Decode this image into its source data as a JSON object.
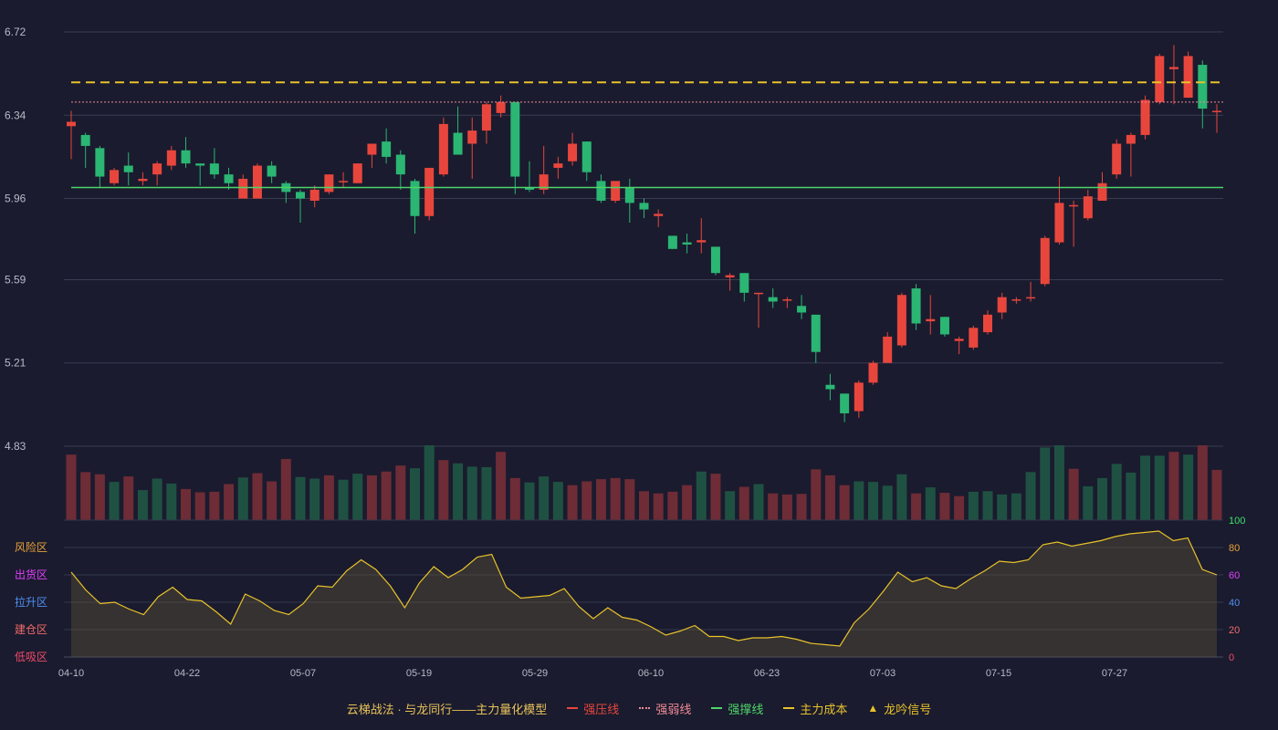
{
  "chart_data": {
    "type": "candlestick",
    "x_ticks": [
      "04-10",
      "04-22",
      "05-07",
      "05-19",
      "05-29",
      "06-10",
      "06-23",
      "07-03",
      "07-15",
      "07-27"
    ],
    "y_ticks": [
      "6.72",
      "6.34",
      "5.96",
      "5.59",
      "5.21",
      "4.83"
    ],
    "price_range": [
      4.83,
      6.72
    ],
    "lines": {
      "resistance": 6.4,
      "weak": 6.45,
      "support": 6.01,
      "cost": 6.49
    },
    "candles": [
      [
        6.29,
        6.31,
        6.36,
        6.14
      ],
      [
        6.25,
        6.2,
        6.26,
        6.1
      ],
      [
        6.19,
        6.06,
        6.2,
        6.01
      ],
      [
        6.03,
        6.09,
        6.1,
        6.02
      ],
      [
        6.11,
        6.08,
        6.17,
        6.02
      ],
      [
        6.04,
        6.05,
        6.08,
        6.02
      ],
      [
        6.07,
        6.12,
        6.13,
        6.02
      ],
      [
        6.11,
        6.18,
        6.2,
        6.09
      ],
      [
        6.18,
        6.12,
        6.24,
        6.1
      ],
      [
        6.12,
        6.11,
        6.12,
        6.02
      ],
      [
        6.12,
        6.07,
        6.19,
        6.05
      ],
      [
        6.07,
        6.03,
        6.1,
        6.0
      ],
      [
        5.96,
        6.05,
        6.07,
        5.96
      ],
      [
        5.96,
        6.11,
        6.12,
        5.96
      ],
      [
        6.11,
        6.06,
        6.13,
        6.03
      ],
      [
        6.03,
        5.99,
        6.04,
        5.94
      ],
      [
        5.99,
        5.96,
        6.0,
        5.85
      ],
      [
        5.95,
        6.0,
        6.02,
        5.92
      ],
      [
        5.99,
        6.07,
        6.07,
        5.98
      ],
      [
        6.04,
        6.04,
        6.08,
        6.01
      ],
      [
        6.03,
        6.12,
        6.12,
        6.03
      ],
      [
        6.16,
        6.21,
        6.21,
        6.1
      ],
      [
        6.22,
        6.15,
        6.28,
        6.12
      ],
      [
        6.16,
        6.07,
        6.18,
        6.0
      ],
      [
        6.04,
        5.88,
        6.05,
        5.8
      ],
      [
        5.88,
        6.1,
        6.1,
        5.86
      ],
      [
        6.07,
        6.3,
        6.33,
        6.06
      ],
      [
        6.26,
        6.16,
        6.38,
        6.16
      ],
      [
        6.21,
        6.27,
        6.33,
        6.05
      ],
      [
        6.27,
        6.39,
        6.4,
        6.21
      ],
      [
        6.35,
        6.4,
        6.43,
        6.33
      ],
      [
        6.4,
        6.06,
        6.4,
        5.98
      ],
      [
        6.01,
        6.0,
        6.13,
        5.99
      ],
      [
        6.0,
        6.07,
        6.2,
        5.98
      ],
      [
        6.1,
        6.12,
        6.15,
        6.05
      ],
      [
        6.13,
        6.21,
        6.26,
        6.11
      ],
      [
        6.22,
        6.08,
        6.22,
        6.04
      ],
      [
        6.04,
        5.95,
        6.07,
        5.94
      ],
      [
        5.95,
        6.04,
        6.04,
        5.94
      ],
      [
        6.01,
        5.94,
        6.05,
        5.85
      ],
      [
        5.94,
        5.91,
        5.96,
        5.87
      ],
      [
        5.88,
        5.89,
        5.91,
        5.83
      ],
      [
        5.79,
        5.73,
        5.79,
        5.73
      ],
      [
        5.76,
        5.75,
        5.8,
        5.71
      ],
      [
        5.76,
        5.77,
        5.87,
        5.71
      ],
      [
        5.74,
        5.62,
        5.74,
        5.61
      ],
      [
        5.6,
        5.61,
        5.62,
        5.54
      ],
      [
        5.62,
        5.53,
        5.62,
        5.49
      ],
      [
        5.53,
        5.53,
        5.53,
        5.37
      ],
      [
        5.51,
        5.49,
        5.55,
        5.46
      ],
      [
        5.5,
        5.5,
        5.51,
        5.46
      ],
      [
        5.47,
        5.44,
        5.52,
        5.41
      ],
      [
        5.43,
        5.26,
        5.43,
        5.21
      ],
      [
        5.11,
        5.09,
        5.16,
        5.04
      ],
      [
        5.07,
        4.98,
        5.07,
        4.94
      ],
      [
        4.99,
        5.12,
        5.13,
        4.96
      ],
      [
        5.12,
        5.21,
        5.22,
        5.11
      ],
      [
        5.21,
        5.33,
        5.35,
        5.21
      ],
      [
        5.29,
        5.52,
        5.53,
        5.28
      ],
      [
        5.55,
        5.39,
        5.57,
        5.36
      ],
      [
        5.4,
        5.41,
        5.52,
        5.34
      ],
      [
        5.42,
        5.34,
        5.42,
        5.33
      ],
      [
        5.31,
        5.32,
        5.33,
        5.25
      ],
      [
        5.28,
        5.37,
        5.38,
        5.27
      ],
      [
        5.35,
        5.43,
        5.45,
        5.34
      ],
      [
        5.44,
        5.51,
        5.53,
        5.41
      ],
      [
        5.5,
        5.5,
        5.51,
        5.48
      ],
      [
        5.51,
        5.51,
        5.58,
        5.49
      ],
      [
        5.57,
        5.78,
        5.79,
        5.56
      ],
      [
        5.76,
        5.94,
        6.06,
        5.75
      ],
      [
        5.93,
        5.93,
        5.95,
        5.74
      ],
      [
        5.87,
        5.97,
        6.0,
        5.86
      ],
      [
        5.95,
        6.03,
        6.08,
        5.95
      ],
      [
        6.07,
        6.21,
        6.23,
        6.05
      ],
      [
        6.21,
        6.25,
        6.26,
        6.06
      ],
      [
        6.25,
        6.41,
        6.43,
        6.23
      ],
      [
        6.4,
        6.61,
        6.62,
        6.39
      ],
      [
        6.55,
        6.56,
        6.66,
        6.39
      ],
      [
        6.42,
        6.61,
        6.63,
        6.42
      ],
      [
        6.57,
        6.37,
        6.59,
        6.28
      ],
      [
        6.36,
        6.36,
        6.39,
        6.26
      ]
    ],
    "volume": [
      [
        120,
        "r"
      ],
      [
        88,
        "r"
      ],
      [
        84,
        "r"
      ],
      [
        70,
        "g"
      ],
      [
        80,
        "r"
      ],
      [
        55,
        "g"
      ],
      [
        76,
        "g"
      ],
      [
        67,
        "g"
      ],
      [
        57,
        "r"
      ],
      [
        51,
        "r"
      ],
      [
        52,
        "r"
      ],
      [
        66,
        "r"
      ],
      [
        78,
        "g"
      ],
      [
        86,
        "r"
      ],
      [
        71,
        "r"
      ],
      [
        112,
        "r"
      ],
      [
        79,
        "g"
      ],
      [
        76,
        "g"
      ],
      [
        82,
        "r"
      ],
      [
        74,
        "g"
      ],
      [
        85,
        "g"
      ],
      [
        82,
        "r"
      ],
      [
        89,
        "r"
      ],
      [
        100,
        "r"
      ],
      [
        95,
        "g"
      ],
      [
        137,
        "g"
      ],
      [
        110,
        "r"
      ],
      [
        104,
        "g"
      ],
      [
        98,
        "g"
      ],
      [
        97,
        "g"
      ],
      [
        125,
        "r"
      ],
      [
        77,
        "r"
      ],
      [
        69,
        "g"
      ],
      [
        80,
        "g"
      ],
      [
        70,
        "g"
      ],
      [
        64,
        "r"
      ],
      [
        71,
        "r"
      ],
      [
        75,
        "r"
      ],
      [
        77,
        "r"
      ],
      [
        75,
        "r"
      ],
      [
        53,
        "r"
      ],
      [
        49,
        "r"
      ],
      [
        52,
        "r"
      ],
      [
        64,
        "r"
      ],
      [
        89,
        "g"
      ],
      [
        85,
        "r"
      ],
      [
        53,
        "g"
      ],
      [
        61,
        "r"
      ],
      [
        66,
        "g"
      ],
      [
        49,
        "r"
      ],
      [
        47,
        "r"
      ],
      [
        48,
        "r"
      ],
      [
        93,
        "r"
      ],
      [
        82,
        "r"
      ],
      [
        64,
        "r"
      ],
      [
        71,
        "g"
      ],
      [
        70,
        "g"
      ],
      [
        63,
        "g"
      ],
      [
        84,
        "g"
      ],
      [
        49,
        "r"
      ],
      [
        60,
        "g"
      ],
      [
        50,
        "r"
      ],
      [
        44,
        "r"
      ],
      [
        52,
        "g"
      ],
      [
        53,
        "g"
      ],
      [
        47,
        "g"
      ],
      [
        49,
        "g"
      ],
      [
        88,
        "g"
      ],
      [
        133,
        "g"
      ],
      [
        137,
        "g"
      ],
      [
        94,
        "r"
      ],
      [
        62,
        "g"
      ],
      [
        77,
        "g"
      ],
      [
        103,
        "g"
      ],
      [
        87,
        "g"
      ],
      [
        118,
        "g"
      ],
      [
        118,
        "g"
      ],
      [
        125,
        "r"
      ],
      [
        120,
        "g"
      ],
      [
        137,
        "r"
      ],
      [
        92,
        "r"
      ]
    ],
    "indicator": {
      "axis": [
        "100",
        "80",
        "60",
        "40",
        "20",
        "0"
      ],
      "zones": [
        "风险区",
        "出货区",
        "拉升区",
        "建仓区",
        "低吸区"
      ],
      "values": [
        62,
        49,
        39,
        40,
        35,
        31,
        44,
        51,
        42,
        41,
        33,
        24,
        46,
        41,
        34,
        31,
        39,
        52,
        51,
        63,
        71,
        64,
        52,
        36,
        54,
        66,
        58,
        64,
        73,
        75,
        51,
        43,
        44,
        45,
        50,
        37,
        28,
        36,
        29,
        27,
        22,
        16,
        19,
        23,
        15,
        15,
        12,
        14,
        14,
        15,
        13,
        10,
        9,
        8,
        25,
        35,
        48,
        62,
        55,
        58,
        52,
        50,
        57,
        63,
        70,
        69,
        71,
        82,
        84,
        81,
        83,
        85,
        88,
        90,
        91,
        92,
        85,
        87,
        64,
        60
      ]
    }
  },
  "legend": {
    "title": "云梯战法 · 与龙同行——主力量化模型",
    "resistance": "强压线",
    "weak": "强弱线",
    "support": "强撑线",
    "cost": "主力成本",
    "signal": "龙吟信号"
  },
  "colors": {
    "background": "#1a1b2e",
    "up": "#e8463d",
    "down": "#2bb673",
    "vol_up": "#6e2c36",
    "vol_down": "#1f5142",
    "resistance": "#e8463d",
    "weak": "#f08a96",
    "support": "#4fd46a",
    "cost": "#e8c22a",
    "indicator_line": "#e8c22a",
    "zone_risk": "#e8a23a",
    "zone_sell": "#e040fb",
    "zone_rise": "#4f8ff0",
    "zone_build": "#f06a6a",
    "zone_low": "#f04a6a",
    "axis_100": "#3fe06a",
    "axis_80": "#e8a23a",
    "axis_60": "#e040fb",
    "axis_40": "#4f8ff0",
    "axis_20": "#f06a6a",
    "axis_0": "#f04a6a"
  }
}
